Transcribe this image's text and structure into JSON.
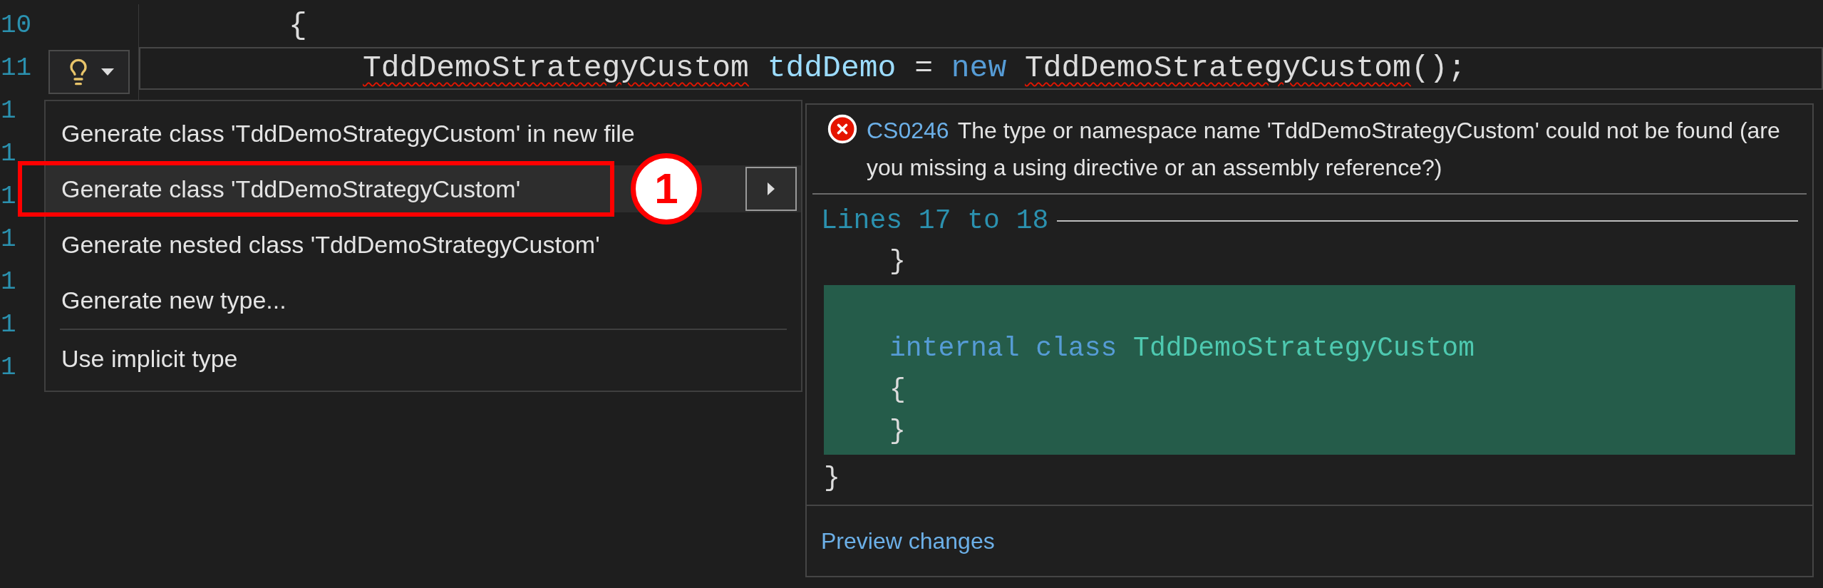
{
  "editor": {
    "line_numbers": [
      "10",
      "11",
      "1",
      "1",
      "1",
      "1",
      "1",
      "1",
      "1"
    ],
    "code_lines": [
      {
        "tokens": [
          {
            "text": "{",
            "kind": "plain"
          }
        ],
        "children": [
          {
            "current": true,
            "tokens": [
              {
                "text": "TddDemoStrategyCustom",
                "kind": "plain",
                "error": true
              },
              {
                "text": "tddDemo",
                "kind": "variable"
              },
              {
                "text": "=",
                "kind": "plain"
              },
              {
                "text": "new",
                "kind": "keyword"
              },
              {
                "text": "TddDemoStrategyCustom",
                "kind": "plain",
                "error": true
              },
              {
                "text": "();",
                "kind": "punct"
              }
            ]
          }
        ]
      }
    ]
  },
  "quick_actions": {
    "items": [
      {
        "kind": "action",
        "label": "Generate class 'TddDemoStrategyCustom' in new file",
        "selected": false,
        "submenu": false
      },
      {
        "kind": "action",
        "label": "Generate class 'TddDemoStrategyCustom'",
        "selected": true,
        "submenu": true
      },
      {
        "kind": "action",
        "label": "Generate nested class 'TddDemoStrategyCustom'",
        "selected": false,
        "submenu": false
      },
      {
        "kind": "action",
        "label": "Generate new type...",
        "selected": false,
        "submenu": false
      },
      {
        "kind": "separator"
      },
      {
        "kind": "action",
        "label": "Use implicit type",
        "selected": false,
        "submenu": false
      }
    ]
  },
  "annotation": {
    "callout": "1"
  },
  "preview": {
    "error_code": "CS0246",
    "message": "The type or namespace name 'TddDemoStrategyCustom' could not be found (are you missing a using directive or an assembly reference?)",
    "range": "Lines 17 to 18",
    "code": {
      "children": [
        {
          "added": false,
          "tokens": [
            {
              "text": "}",
              "kind": "plain"
            }
          ]
        },
        {
          "added": true,
          "tokens": [
            {
              "text": "internal class",
              "kind": "keyword"
            },
            {
              "text": "TddDemoStrategyCustom",
              "kind": "type"
            }
          ]
        },
        {
          "added": true,
          "tokens": [
            {
              "text": "{",
              "kind": "plain"
            }
          ]
        },
        {
          "added": true,
          "tokens": [
            {
              "text": "}",
              "kind": "plain"
            }
          ]
        }
      ],
      "closing": {
        "text": "}",
        "kind": "plain"
      }
    },
    "link": "Preview changes"
  }
}
